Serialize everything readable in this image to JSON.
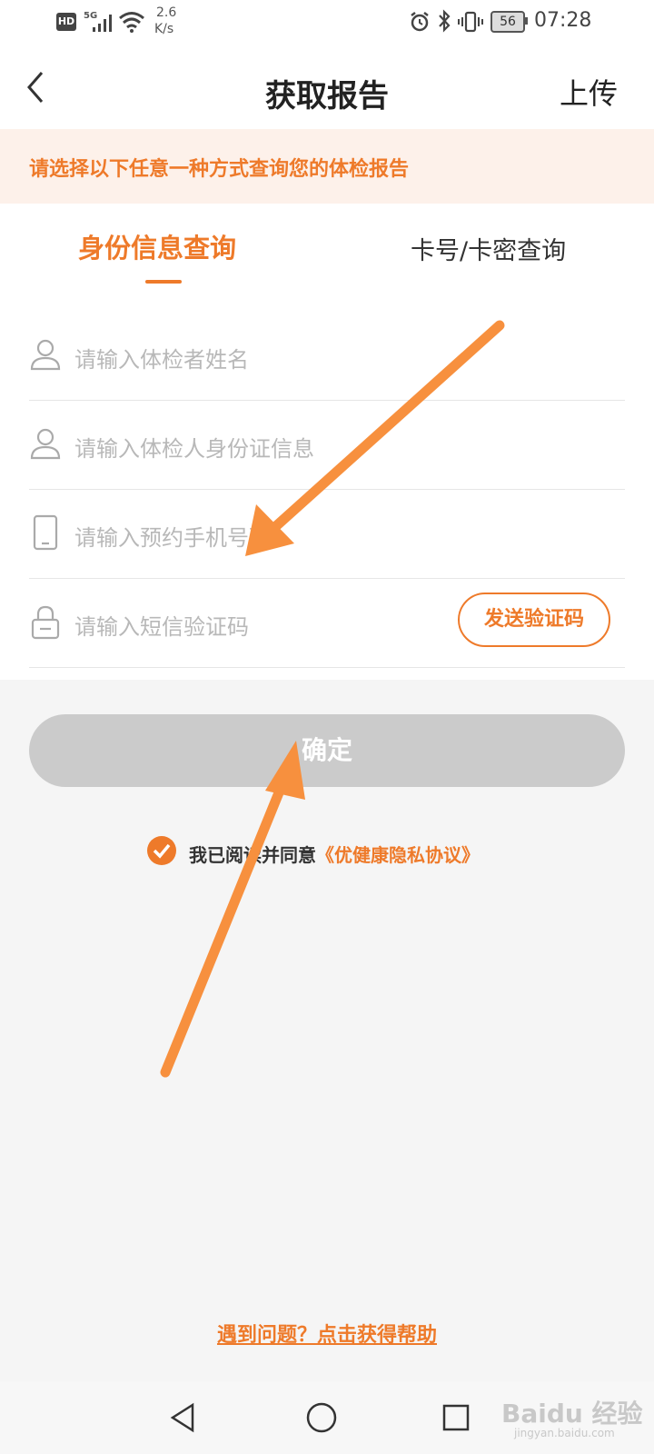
{
  "status_bar": {
    "hd": "HD",
    "net": "5G",
    "speed_value": "2.6",
    "speed_unit": "K/s",
    "battery": "56",
    "time": "07:28"
  },
  "nav": {
    "title": "获取报告",
    "upload": "上传"
  },
  "notice": "请选择以下任意一种方式查询您的体检报告",
  "tabs": [
    {
      "label": "身份信息查询",
      "active": true
    },
    {
      "label": "卡号/卡密查询",
      "active": false
    }
  ],
  "fields": [
    {
      "icon": "user-icon",
      "placeholder": "请输入体检者姓名"
    },
    {
      "icon": "user-icon",
      "placeholder": "请输入体检人身份证信息"
    },
    {
      "icon": "phone-icon",
      "placeholder": "请输入预约手机号码"
    },
    {
      "icon": "lock-icon",
      "placeholder": "请输入短信验证码"
    }
  ],
  "send_code_label": "发送验证码",
  "confirm_label": "确定",
  "agreement": {
    "checked": true,
    "text": "我已阅读并同意",
    "link": "《优健康隐私协议》"
  },
  "help_link": "遇到问题？点击获得帮助",
  "watermark": {
    "main": "Baidu 经验",
    "sub": "jingyan.baidu.com"
  },
  "colors": {
    "accent": "#ee7a2a",
    "notice_bg": "#fdf1ea",
    "disabled_button": "#cbcbcb",
    "annotation_arrow": "#f7903e"
  }
}
